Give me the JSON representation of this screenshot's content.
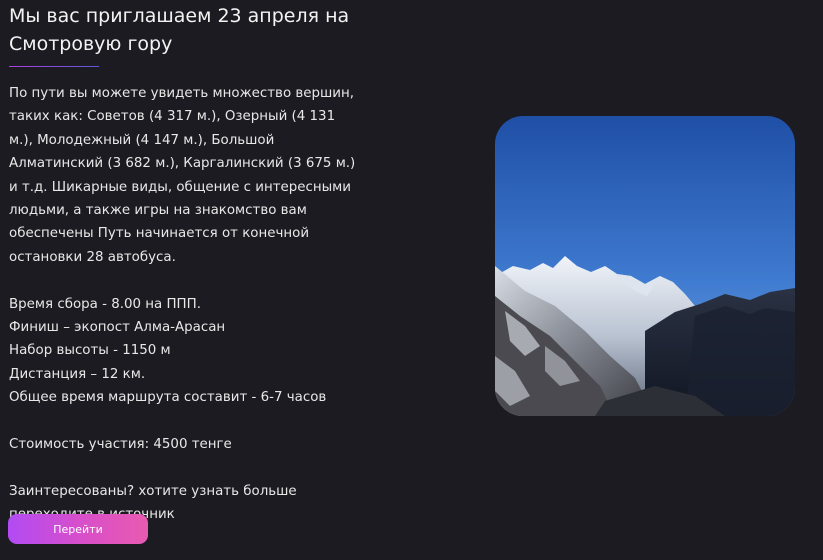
{
  "header": {
    "title": "Мы вас приглашаем 23 апреля на Смотровую гору"
  },
  "content": {
    "description": "По пути вы можете увидеть множество вершин, таких как: Советов (4 317 м.), Озерный (4 131 м.), Молодежный (4 147 м.), Большой Алматинский (3 682 м.), Каргалинский (3 675 м.) и т.д. Шикарные виды, общение с интересными людьми, а также игры на знакомство вам обеспечены Путь начинается от конечной остановки 28 автобуса.",
    "details": [
      "Время сбора - 8.00 на ППП.",
      "Финиш – экопост Алма-Арасан",
      "Набор высоты - 1150 м",
      "Дистанция – 12 км.",
      "Общее время маршрута составит - 6-7 часов"
    ],
    "price": "Стоимость участия: 4500 тенге",
    "cta_text_line1": "Заинтересованы? хотите узнать больше",
    "cta_text_line2": "переходите в источник"
  },
  "button": {
    "label": "Перейти"
  },
  "colors": {
    "background": "#1d1b22",
    "button_gradient_start": "#b24bf3",
    "button_gradient_end": "#e85bb0"
  }
}
